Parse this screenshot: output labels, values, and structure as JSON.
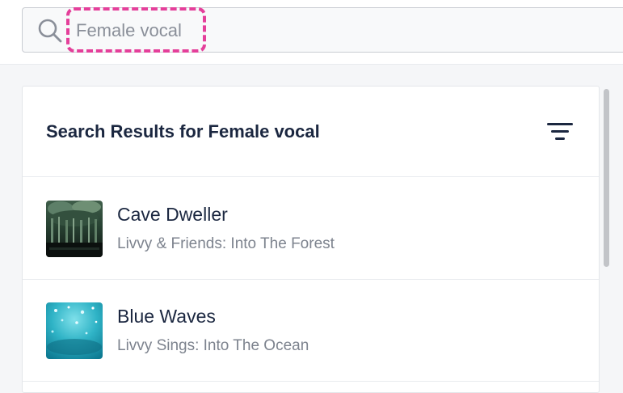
{
  "search": {
    "icon": "search-icon",
    "value": "Female vocal",
    "highlight_color": "#e43f9a"
  },
  "results": {
    "title": "Search Results for Female vocal",
    "filter_icon": "filter-icon",
    "items": [
      {
        "title": "Cave Dweller",
        "subtitle": "Livvy & Friends: Into The Forest",
        "thumbnail": "forest-cave-artwork"
      },
      {
        "title": "Blue Waves",
        "subtitle": "Livvy Sings: Into The Ocean",
        "thumbnail": "ocean-water-artwork"
      }
    ]
  },
  "colors": {
    "text_dark": "#1b2740",
    "text_muted": "#7d838e",
    "background": "#f5f6f8"
  }
}
